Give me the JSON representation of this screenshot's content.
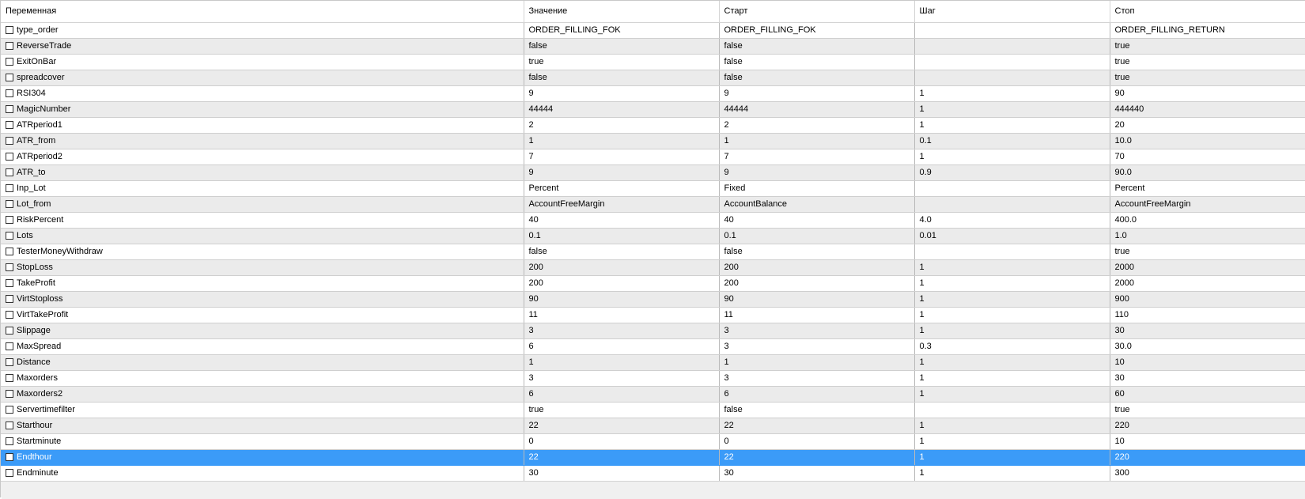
{
  "columns": {
    "variable": "Переменная",
    "value": "Значение",
    "start": "Старт",
    "step": "Шаг",
    "stop": "Стоп"
  },
  "selected_row": 27,
  "rows": [
    {
      "name": "type_order",
      "value": "ORDER_FILLING_FOK",
      "start": "ORDER_FILLING_FOK",
      "step": "",
      "stop": "ORDER_FILLING_RETURN",
      "checked": false
    },
    {
      "name": "ReverseTrade",
      "value": "false",
      "start": "false",
      "step": "",
      "stop": "true",
      "checked": false
    },
    {
      "name": "ExitOnBar",
      "value": "true",
      "start": "false",
      "step": "",
      "stop": "true",
      "checked": false
    },
    {
      "name": "spreadcover",
      "value": "false",
      "start": "false",
      "step": "",
      "stop": "true",
      "checked": false
    },
    {
      "name": "RSI304",
      "value": "9",
      "start": "9",
      "step": "1",
      "stop": "90",
      "checked": false
    },
    {
      "name": "MagicNumber",
      "value": "44444",
      "start": "44444",
      "step": "1",
      "stop": "444440",
      "checked": false
    },
    {
      "name": "ATRperiod1",
      "value": "2",
      "start": "2",
      "step": "1",
      "stop": "20",
      "checked": false
    },
    {
      "name": "ATR_from",
      "value": "1",
      "start": "1",
      "step": "0.1",
      "stop": "10.0",
      "checked": false
    },
    {
      "name": "ATRperiod2",
      "value": "7",
      "start": "7",
      "step": "1",
      "stop": "70",
      "checked": false
    },
    {
      "name": "ATR_to",
      "value": "9",
      "start": "9",
      "step": "0.9",
      "stop": "90.0",
      "checked": false
    },
    {
      "name": "Inp_Lot",
      "value": "Percent",
      "start": "Fixed",
      "step": "",
      "stop": "Percent",
      "checked": false
    },
    {
      "name": "Lot_from",
      "value": "AccountFreeMargin",
      "start": "AccountBalance",
      "step": "",
      "stop": "AccountFreeMargin",
      "checked": false
    },
    {
      "name": "RiskPercent",
      "value": "40",
      "start": "40",
      "step": "4.0",
      "stop": "400.0",
      "checked": false
    },
    {
      "name": "Lots",
      "value": "0.1",
      "start": "0.1",
      "step": "0.01",
      "stop": "1.0",
      "checked": false
    },
    {
      "name": "TesterMoneyWithdraw",
      "value": "false",
      "start": "false",
      "step": "",
      "stop": "true",
      "checked": false
    },
    {
      "name": "StopLoss",
      "value": "200",
      "start": "200",
      "step": "1",
      "stop": "2000",
      "checked": false
    },
    {
      "name": "TakeProfit",
      "value": "200",
      "start": "200",
      "step": "1",
      "stop": "2000",
      "checked": false
    },
    {
      "name": "VirtStoploss",
      "value": "90",
      "start": "90",
      "step": "1",
      "stop": "900",
      "checked": false
    },
    {
      "name": "VirtTakeProfit",
      "value": "11",
      "start": "11",
      "step": "1",
      "stop": "110",
      "checked": false
    },
    {
      "name": "Slippage",
      "value": "3",
      "start": "3",
      "step": "1",
      "stop": "30",
      "checked": false
    },
    {
      "name": "MaxSpread",
      "value": "6",
      "start": "3",
      "step": "0.3",
      "stop": "30.0",
      "checked": false
    },
    {
      "name": "Distance",
      "value": "1",
      "start": "1",
      "step": "1",
      "stop": "10",
      "checked": false
    },
    {
      "name": "Maxorders",
      "value": "3",
      "start": "3",
      "step": "1",
      "stop": "30",
      "checked": false
    },
    {
      "name": "Maxorders2",
      "value": "6",
      "start": "6",
      "step": "1",
      "stop": "60",
      "checked": false
    },
    {
      "name": "Servertimefilter",
      "value": "true",
      "start": "false",
      "step": "",
      "stop": "true",
      "checked": false
    },
    {
      "name": "Starthour",
      "value": "22",
      "start": "22",
      "step": "1",
      "stop": "220",
      "checked": false
    },
    {
      "name": "Startminute",
      "value": "0",
      "start": "0",
      "step": "1",
      "stop": "10",
      "checked": false
    },
    {
      "name": "Endthour",
      "value": "22",
      "start": "22",
      "step": "1",
      "stop": "220",
      "checked": false
    },
    {
      "name": "Endminute",
      "value": "30",
      "start": "30",
      "step": "1",
      "stop": "300",
      "checked": false
    }
  ]
}
